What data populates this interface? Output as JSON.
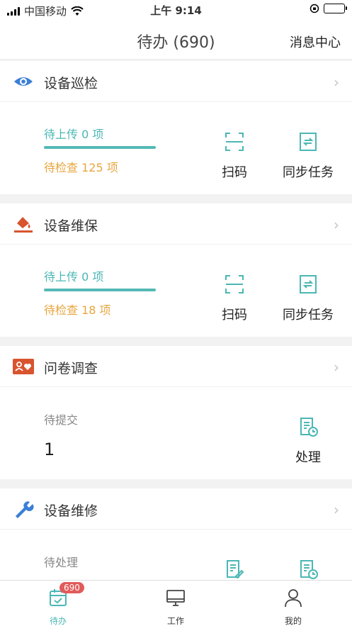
{
  "status_bar": {
    "carrier": "中国移动",
    "time": "上午 9:14"
  },
  "nav": {
    "title": "待办 (690)",
    "message_center": "消息中心"
  },
  "inspection": {
    "title": "设备巡检",
    "pending_upload": "待上传 0 项",
    "upload_progress": 1.0,
    "pending_check": "待检查 125 项",
    "scan_label": "扫码",
    "sync_label": "同步任务"
  },
  "maintenance": {
    "title": "设备维保",
    "pending_upload": "待上传 0 项",
    "upload_progress": 1.0,
    "pending_check": "待检查 18 项",
    "scan_label": "扫码",
    "sync_label": "同步任务"
  },
  "survey": {
    "title": "问卷调查",
    "pending_submit_label": "待提交",
    "pending_submit_count": "1",
    "process_label": "处理"
  },
  "repair": {
    "title": "设备维修",
    "pending_label": "待处理"
  },
  "tab_bar": {
    "todo_label": "待办",
    "todo_badge": "690",
    "work_label": "工作",
    "mine_label": "我的"
  },
  "colors": {
    "accent": "#4bb7b4",
    "warning": "#e8a53e",
    "inspection_icon": "#3b7fd6",
    "maintenance_icon": "#d8542f",
    "badge": "#e25b5b"
  }
}
